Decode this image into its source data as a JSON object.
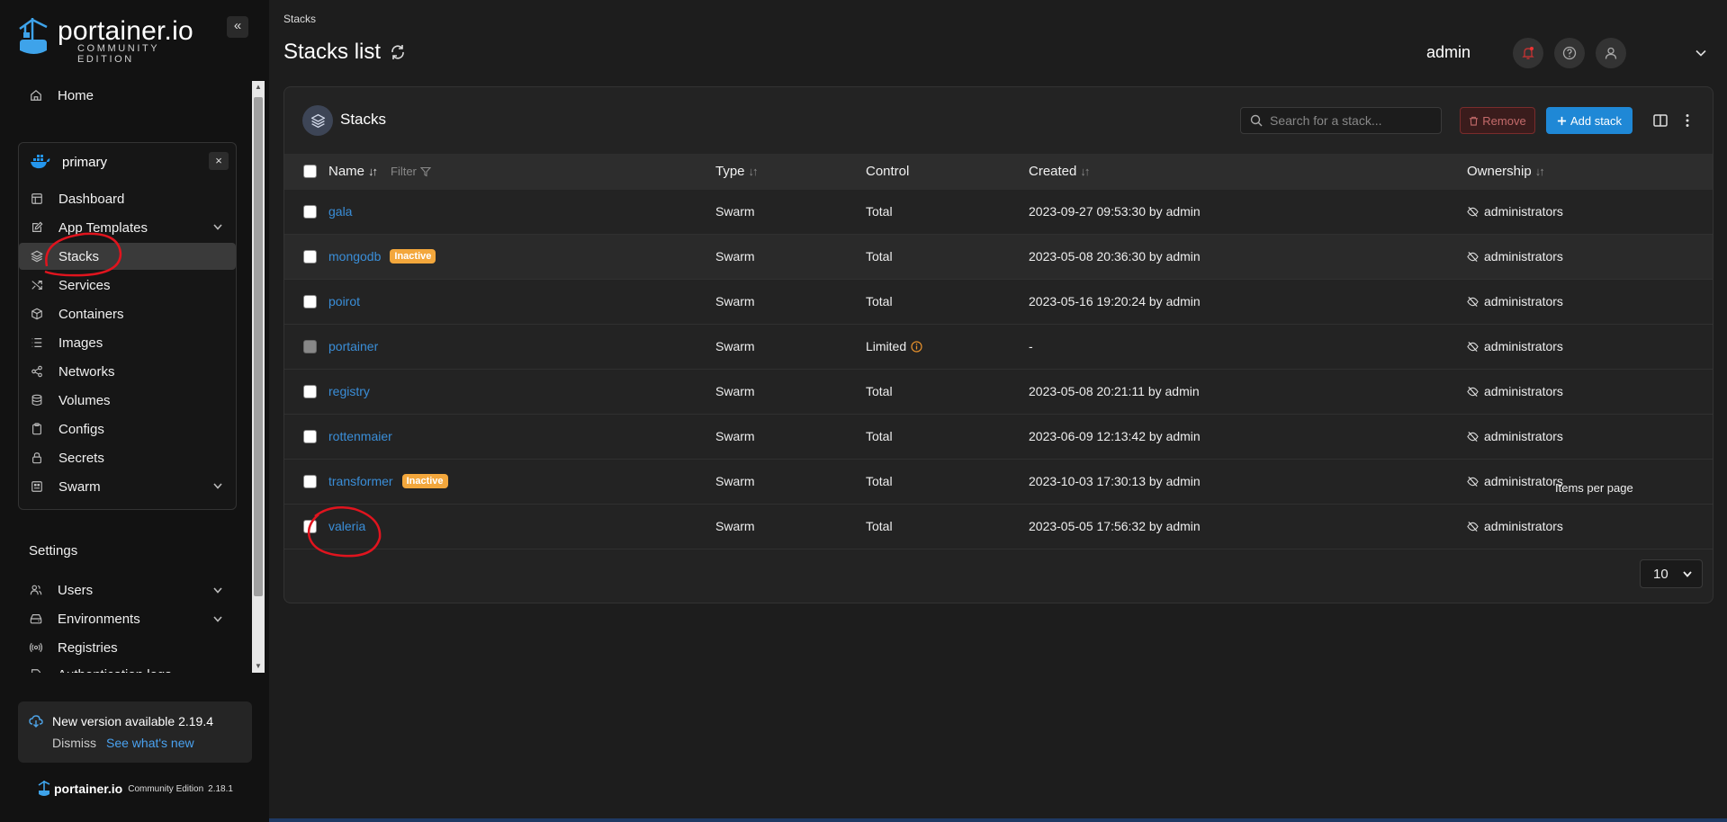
{
  "brand": {
    "name": "portainer.io",
    "edition": "COMMUNITY EDITION",
    "collapse_glyph": "«"
  },
  "sidebar": {
    "home_label": "Home",
    "environment": {
      "name": "primary",
      "close_glyph": "×",
      "items": [
        {
          "label": "Dashboard",
          "icon": "dashboard-icon",
          "expandable": false
        },
        {
          "label": "App Templates",
          "icon": "edit-icon",
          "expandable": true
        },
        {
          "label": "Stacks",
          "icon": "layers-icon",
          "expandable": false,
          "active": true
        },
        {
          "label": "Services",
          "icon": "shuffle-icon",
          "expandable": false
        },
        {
          "label": "Containers",
          "icon": "box-icon",
          "expandable": false
        },
        {
          "label": "Images",
          "icon": "list-icon",
          "expandable": false
        },
        {
          "label": "Networks",
          "icon": "share-icon",
          "expandable": false
        },
        {
          "label": "Volumes",
          "icon": "database-icon",
          "expandable": false
        },
        {
          "label": "Configs",
          "icon": "clipboard-icon",
          "expandable": false
        },
        {
          "label": "Secrets",
          "icon": "lock-icon",
          "expandable": false
        },
        {
          "label": "Swarm",
          "icon": "swarm-icon",
          "expandable": true
        }
      ]
    },
    "settings_title": "Settings",
    "settings_items": [
      {
        "label": "Users",
        "icon": "users-icon",
        "expandable": true
      },
      {
        "label": "Environments",
        "icon": "hdd-icon",
        "expandable": true
      },
      {
        "label": "Registries",
        "icon": "radio-icon",
        "expandable": false
      },
      {
        "label": "Authentication logs",
        "icon": "log-icon",
        "expandable": true
      }
    ],
    "update": {
      "title": "New version available 2.19.4",
      "dismiss": "Dismiss",
      "whats_new": "See what's new"
    },
    "footer": {
      "brand": "portainer.io",
      "edition": "Community Edition",
      "version": "2.18.1"
    }
  },
  "header": {
    "breadcrumb": "Stacks",
    "title": "Stacks list",
    "user": "admin"
  },
  "card": {
    "title": "Stacks",
    "search_placeholder": "Search for a stack...",
    "remove_label": "Remove",
    "add_label": "Add stack"
  },
  "table": {
    "columns": {
      "name": "Name",
      "filter": "Filter",
      "type": "Type",
      "control": "Control",
      "created": "Created",
      "ownership": "Ownership"
    },
    "rows": [
      {
        "name": "gala",
        "badge": "",
        "type": "Swarm",
        "control": "Total",
        "created": "2023-09-27 09:53:30 by admin",
        "ownership": "administrators",
        "disabled": false,
        "limited": false
      },
      {
        "name": "mongodb",
        "badge": "Inactive",
        "type": "Swarm",
        "control": "Total",
        "created": "2023-05-08 20:36:30 by admin",
        "ownership": "administrators",
        "disabled": false,
        "limited": false
      },
      {
        "name": "poirot",
        "badge": "",
        "type": "Swarm",
        "control": "Total",
        "created": "2023-05-16 19:20:24 by admin",
        "ownership": "administrators",
        "disabled": false,
        "limited": false
      },
      {
        "name": "portainer",
        "badge": "",
        "type": "Swarm",
        "control": "Limited",
        "created": "-",
        "ownership": "administrators",
        "disabled": true,
        "limited": true
      },
      {
        "name": "registry",
        "badge": "",
        "type": "Swarm",
        "control": "Total",
        "created": "2023-05-08 20:21:11 by admin",
        "ownership": "administrators",
        "disabled": false,
        "limited": false
      },
      {
        "name": "rottenmaier",
        "badge": "",
        "type": "Swarm",
        "control": "Total",
        "created": "2023-06-09 12:13:42 by admin",
        "ownership": "administrators",
        "disabled": false,
        "limited": false
      },
      {
        "name": "transformer",
        "badge": "Inactive",
        "type": "Swarm",
        "control": "Total",
        "created": "2023-10-03 17:30:13 by admin",
        "ownership": "administrators",
        "disabled": false,
        "limited": false
      },
      {
        "name": "valeria",
        "badge": "",
        "type": "Swarm",
        "control": "Total",
        "created": "2023-05-05 17:56:32 by admin",
        "ownership": "administrators",
        "disabled": false,
        "limited": false
      }
    ],
    "highlight_row": 1
  },
  "pagination": {
    "label": "Items per page",
    "value": "10"
  },
  "colors": {
    "accent": "#1f88d6",
    "link": "#3a8ed8",
    "badge": "#f3a73c",
    "annotation": "#e0141e"
  }
}
